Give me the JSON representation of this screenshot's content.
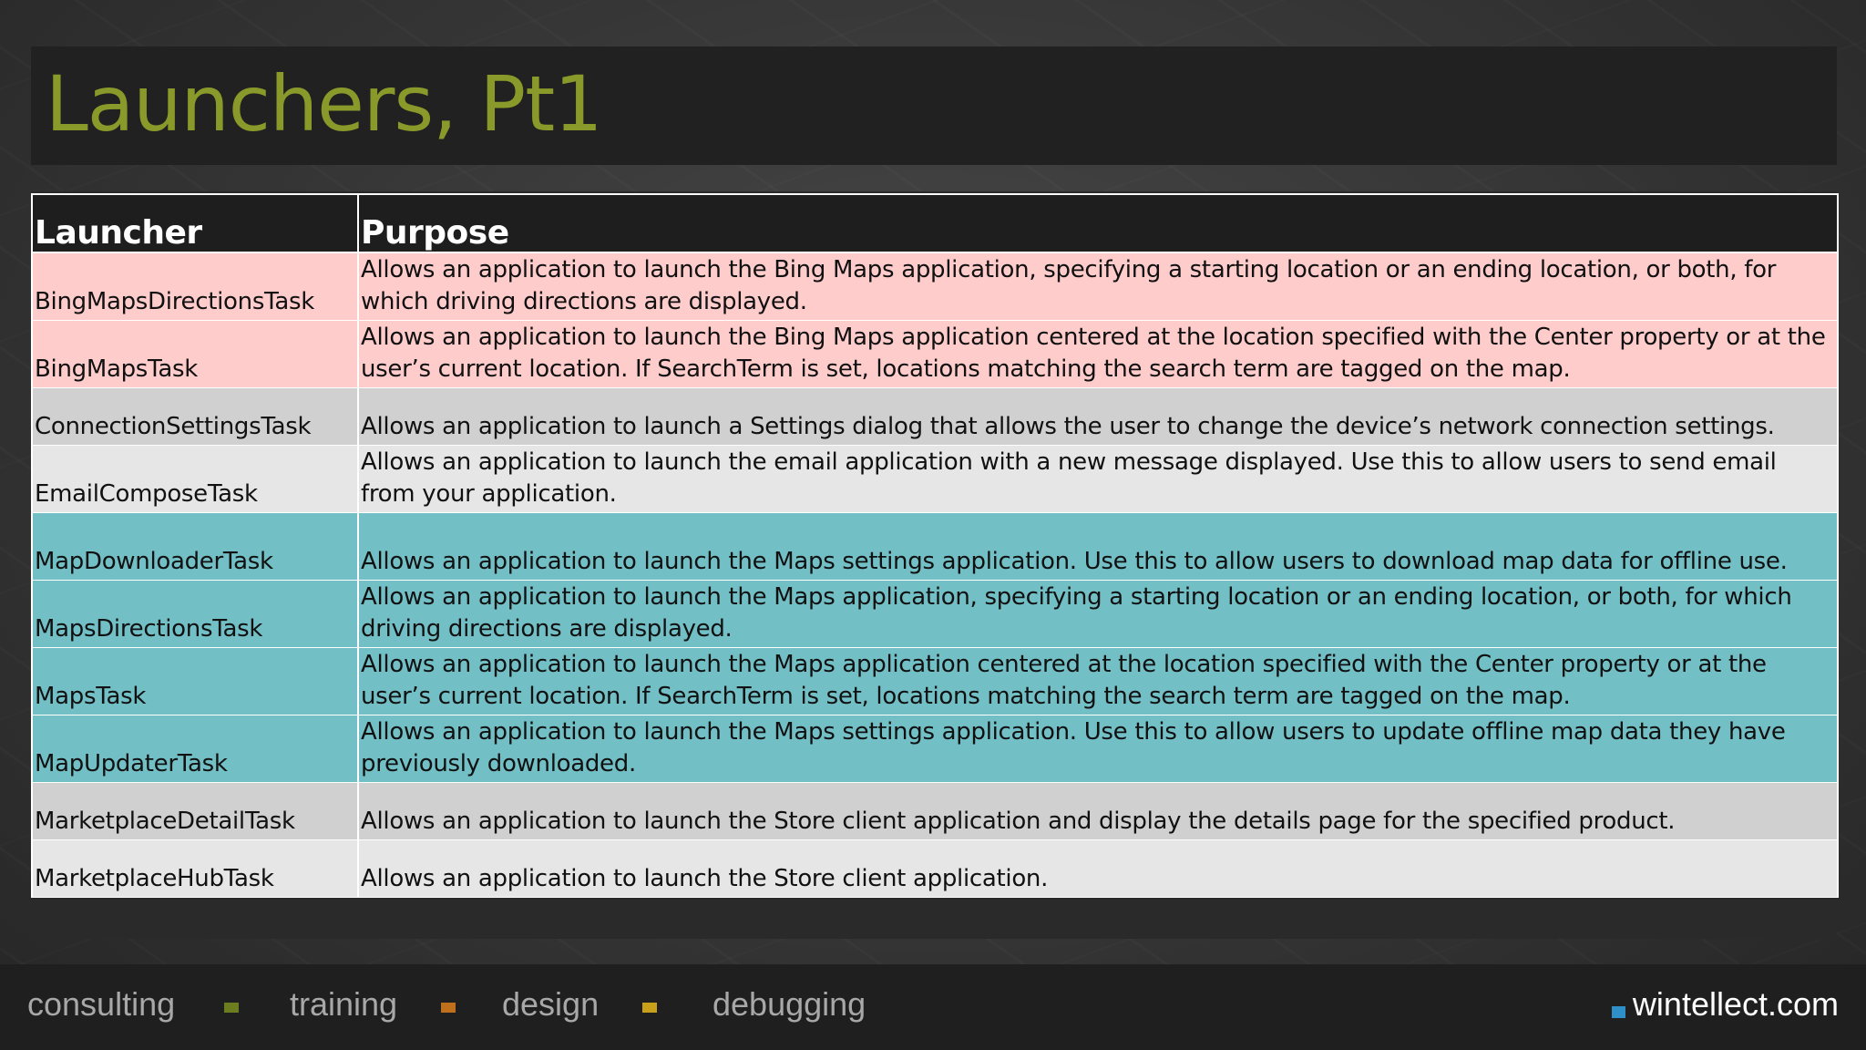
{
  "title": "Launchers, Pt1",
  "table": {
    "headers": [
      "Launcher",
      "Purpose"
    ],
    "rows": [
      {
        "launcher": "BingMapsDirectionsTask",
        "purpose": "Allows an application to launch the Bing Maps application, specifying a starting location or an ending location, or both, for which driving directions are displayed.",
        "color": "#ffcccc"
      },
      {
        "launcher": "BingMapsTask",
        "purpose": "Allows an application to launch the Bing Maps application centered at the location specified with the Center property or at the user’s current location. If SearchTerm is set, locations matching the search term are tagged on the map.",
        "color": "#ffcccc"
      },
      {
        "launcher": "ConnectionSettingsTask",
        "purpose": "Allows an application to launch a Settings dialog that allows the user to change the device’s network connection settings.",
        "color": "#d0d0d0"
      },
      {
        "launcher": "EmailComposeTask",
        "purpose": "Allows an application to launch the email application with a new message displayed. Use this to allow users to send email from your application.",
        "color": "#e6e6e6"
      },
      {
        "launcher": "MapDownloaderTask",
        "purpose": "Allows an application to launch the Maps settings application. Use this to allow users to download map data for offline use.",
        "color": "#72bfc6"
      },
      {
        "launcher": "MapsDirectionsTask",
        "purpose": "Allows an application to launch the Maps application, specifying a starting location or an ending location, or both, for which driving directions are displayed.",
        "color": "#72bfc6"
      },
      {
        "launcher": "MapsTask",
        "purpose": "Allows an application to launch the Maps application centered at the location specified with the Center property or at the user’s current location. If SearchTerm is set, locations matching the search term are tagged on the map.",
        "color": "#72bfc6"
      },
      {
        "launcher": "MapUpdaterTask",
        "purpose": "Allows an application to launch the Maps settings application. Use this to allow users to update offline map data they have previously downloaded.",
        "color": "#72bfc6"
      },
      {
        "launcher": "MarketplaceDetailTask",
        "purpose": "Allows an application to launch the Store client application and display the details page for the specified product.",
        "color": "#d0d0d0"
      },
      {
        "launcher": "MarketplaceHubTask",
        "purpose": "Allows an application to launch the Store client application.",
        "color": "#e6e6e6"
      }
    ]
  },
  "footer": {
    "items": [
      {
        "label": "consulting",
        "dot_color": "#6b7d1f"
      },
      {
        "label": "training",
        "dot_color": "#c0701c"
      },
      {
        "label": "design",
        "dot_color": "#c9a019"
      },
      {
        "label": "debugging"
      }
    ],
    "brand": "wintellect.com",
    "brand_dot_color": "#2f8fc9"
  }
}
